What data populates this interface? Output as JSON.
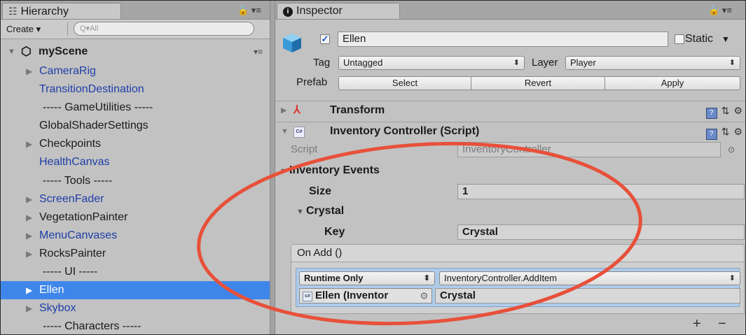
{
  "hierarchy": {
    "tab_icon": "☷",
    "tab_label": "Hierarchy",
    "tab_controls": "🔒 ▾≡",
    "create_label": "Create ▾",
    "search_placeholder": "Q▾All",
    "scene_name": "myScene",
    "scene_menu": "▾≡",
    "items": [
      {
        "label": "CameraRig",
        "arrow": "▶",
        "kind": "prefab"
      },
      {
        "label": "TransitionDestination",
        "arrow": "",
        "kind": "prefab"
      },
      {
        "label": "----- GameUtilities -----",
        "arrow": "",
        "kind": "sep"
      },
      {
        "label": "GlobalShaderSettings",
        "arrow": "",
        "kind": "plain"
      },
      {
        "label": "Checkpoints",
        "arrow": "▶",
        "kind": "plain"
      },
      {
        "label": "HealthCanvas",
        "arrow": "",
        "kind": "prefab"
      },
      {
        "label": "----- Tools -----",
        "arrow": "",
        "kind": "sep"
      },
      {
        "label": "ScreenFader",
        "arrow": "▶",
        "kind": "prefab"
      },
      {
        "label": "VegetationPainter",
        "arrow": "▶",
        "kind": "plain"
      },
      {
        "label": "MenuCanvases",
        "arrow": "▶",
        "kind": "prefab"
      },
      {
        "label": "RocksPainter",
        "arrow": "▶",
        "kind": "plain"
      },
      {
        "label": "----- UI -----",
        "arrow": "",
        "kind": "sep"
      },
      {
        "label": "Ellen",
        "arrow": "▶",
        "kind": "selected"
      },
      {
        "label": "Skybox",
        "arrow": "▶",
        "kind": "prefab"
      },
      {
        "label": "----- Characters -----",
        "arrow": "",
        "kind": "sep"
      }
    ]
  },
  "inspector": {
    "tab_label": "Inspector",
    "tab_controls": "🔒 ▾≡",
    "object_name": "Ellen",
    "active_check": "✓",
    "static_label": "Static",
    "static_caret": "▼",
    "tag_label": "Tag",
    "tag_value": "Untagged",
    "layer_label": "Layer",
    "layer_value": "Player",
    "prefab_label": "Prefab",
    "prefab_select": "Select",
    "prefab_revert": "Revert",
    "prefab_apply": "Apply",
    "transform_title": "Transform",
    "script_component_title": "Inventory Controller (Script)",
    "script_label": "Script",
    "script_value": "InventoryController",
    "inventory_events_label": "Inventory Events",
    "size_label": "Size",
    "size_value": "1",
    "element_label": "Crystal",
    "key_label": "Key",
    "key_value": "Crystal",
    "event_header": "On Add ()",
    "runtime_value": "Runtime Only",
    "function_value": "InventoryController.AddItem",
    "target_object": "Ellen (Inventor",
    "argument_value": "Crystal",
    "plus": "+",
    "minus": "−",
    "component_controls": "⚙",
    "help_glyph": "?"
  },
  "colors": {
    "selection": "#3f86ea",
    "prefab_text": "#1f3ea8",
    "annotation_ellipse": "#e8503a"
  }
}
